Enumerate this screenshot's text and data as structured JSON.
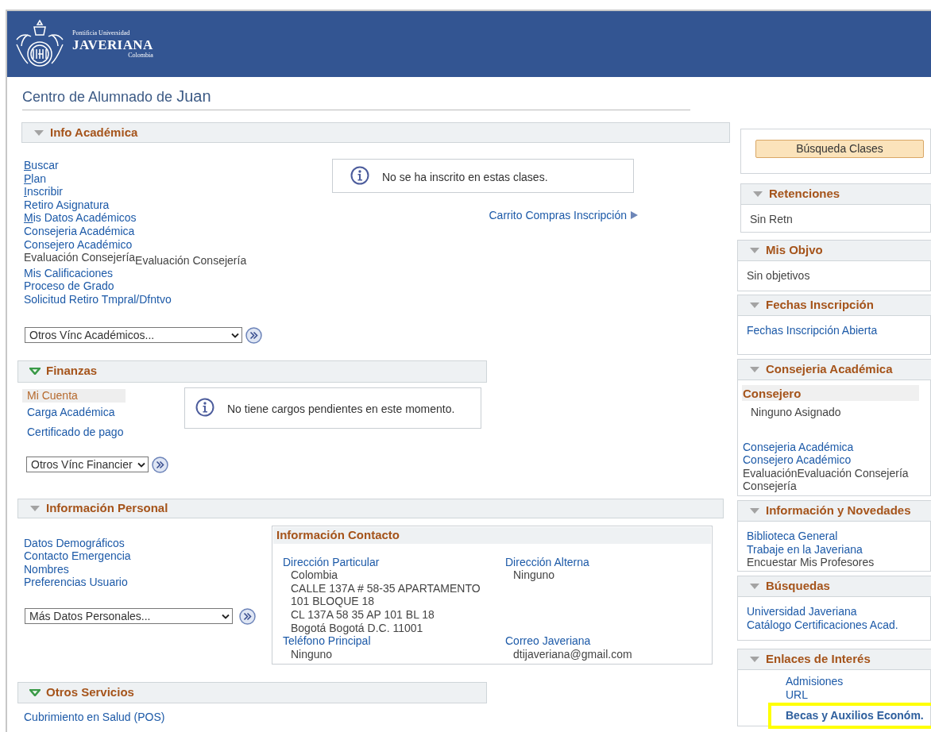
{
  "header": {
    "logo_line_1": "Pontificia Universidad",
    "logo_line_2": "JAVERIANA",
    "logo_line_3": "Colombia"
  },
  "page_title": {
    "prefix": "Centro de Alumnado de",
    "name": "Juan"
  },
  "info_academica": {
    "title": "Info Académica",
    "color": "#a3a3a3",
    "links": [
      {
        "label": "Buscar",
        "kind": "link",
        "accesskey": true
      },
      {
        "label": "Plan",
        "kind": "link",
        "accesskey": true
      },
      {
        "label": "Inscribir",
        "kind": "link",
        "accesskey": true
      },
      {
        "label": "Retiro Asignatura",
        "kind": "link",
        "accesskey": false
      },
      {
        "label": "Mis Datos Académicos",
        "kind": "link",
        "accesskey": true
      },
      {
        "label": "Consejeria Académica",
        "kind": "link",
        "accesskey": false
      },
      {
        "label": "Consejero Académico",
        "kind": "link",
        "accesskey": false
      },
      {
        "label": "Evaluación Consejería",
        "kind": "text",
        "accesskey": false,
        "overlay_label": "Evaluación Consejería"
      },
      {
        "label": "Mis Calificaciones",
        "kind": "link",
        "accesskey": false
      },
      {
        "label": "Proceso de Grado",
        "kind": "link",
        "accesskey": false
      },
      {
        "label": "Solicitud Retiro Tmpral/Dfntvo",
        "kind": "link",
        "accesskey": false
      }
    ],
    "message": "No se ha inscrito en estas clases.",
    "cart_link": "Carrito Compras Inscripción",
    "dropdown": "Otros Vínc Académicos..."
  },
  "finanzas": {
    "title": "Finanzas",
    "color": "#3a9a48",
    "links": [
      {
        "label": "Mi Cuenta",
        "selected": true
      },
      {
        "label": "Carga Académica",
        "selected": false
      },
      {
        "label": "Certificado de pago",
        "selected": false
      }
    ],
    "message": "No tiene cargos pendientes en este momento.",
    "dropdown": "Otros Vínc Financier"
  },
  "informacion_personal": {
    "title": "Información Personal",
    "color": "#a3a3a3",
    "links": [
      "Datos Demográficos",
      "Contacto Emergencia",
      "Nombres",
      "Preferencias Usuario"
    ],
    "dropdown": "Más Datos Personales...",
    "contact": {
      "title": "Información Contacto",
      "rows": [
        [
          {
            "label": "Dirección Particular",
            "lines": [
              "Colombia",
              "CALLE 137A # 58-35 APARTAMENTO",
              "101 BLOQUE 18",
              "CL 137A 58 35 AP 101 BL 18",
              "Bogotá Bogotá D.C. 11001"
            ]
          },
          {
            "label": "Dirección Alterna",
            "lines": [
              "Ninguno"
            ]
          }
        ],
        [
          {
            "label": "Teléfono Principal",
            "lines": [
              "Ninguno"
            ]
          },
          {
            "label": "Correo Javeriana",
            "lines": [
              "dtijaveriana@gmail.com"
            ]
          }
        ]
      ]
    }
  },
  "otros_servicios": {
    "title": "Otros Servicios",
    "color": "#3a9a48",
    "links": [
      "Cubrimiento en Salud (POS)"
    ]
  },
  "sidebar": {
    "search_button": "Búsqueda Clases",
    "panels": [
      {
        "title": "Retenciones",
        "indented": false,
        "groups": [
          [
            {
              "kind": "text",
              "label": "Sin Retn"
            }
          ]
        ]
      },
      {
        "title": "Mis Objvo",
        "indented": false,
        "groups": [
          [
            {
              "kind": "text",
              "label": "Sin objetivos"
            }
          ]
        ]
      },
      {
        "title": "Fechas Inscripción",
        "indented": false,
        "groups": [
          [
            {
              "kind": "link",
              "label": "Fechas Inscripción Abierta"
            }
          ]
        ]
      },
      {
        "title": "Consejeria Académica",
        "indented": false,
        "subheader": "Consejero",
        "groups": [
          [
            {
              "kind": "text",
              "label": "Ninguno Asignado"
            }
          ],
          [
            {
              "kind": "link",
              "label": "Consejeria Académica"
            },
            {
              "kind": "link",
              "label": "Consejero Académico"
            },
            {
              "kind": "text",
              "label": "EvaluaciónEvaluación Consejería"
            },
            {
              "kind": "text",
              "label": "Consejería"
            }
          ]
        ]
      },
      {
        "title": "Información y Novedades",
        "indented": false,
        "groups": [
          [
            {
              "kind": "link",
              "label": "Biblioteca General"
            },
            {
              "kind": "link",
              "label": "Trabaje en la Javeriana"
            },
            {
              "kind": "text",
              "label": "Encuestar Mis Profesores"
            }
          ]
        ]
      },
      {
        "title": "Búsquedas",
        "indented": false,
        "groups": [
          [
            {
              "kind": "link",
              "label": "Universidad Javeriana"
            },
            {
              "kind": "link",
              "label": "Catálogo Certificaciones Acad."
            }
          ]
        ]
      },
      {
        "title": "Enlaces de Interés",
        "indented": true,
        "groups": [
          [
            {
              "kind": "link",
              "label": "Admisiones",
              "highlighted": false
            },
            {
              "kind": "link",
              "label": "URL",
              "highlighted": false
            },
            {
              "kind": "link",
              "label": "Becas y Auxilios Económ.",
              "highlighted": true
            }
          ]
        ]
      }
    ]
  }
}
